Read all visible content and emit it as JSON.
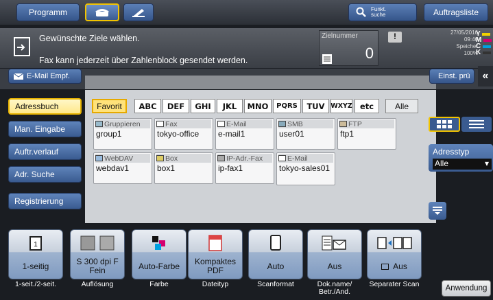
{
  "topbar": {
    "programm": "Programm",
    "funkt_line1": "Funkt.",
    "funkt_line2": "suche",
    "auftragsliste": "Auftragsliste"
  },
  "message": {
    "line1": "Gewünschte Ziele wählen.",
    "line2": "Fax kann jederzeit über Zahlenblock gesendet werden.",
    "zielnummer_label": "Zielnummer",
    "zielnummer_value": "0"
  },
  "status": {
    "date": "27/05/2016",
    "time": "09:46",
    "speicher_label": "Speicher",
    "speicher_value": "100%",
    "toner": [
      "Y",
      "M",
      "C",
      "K"
    ]
  },
  "row2": {
    "email_btn": "E-Mail Empf.",
    "einst_btn": "Einst. prü"
  },
  "sidebar": {
    "items": [
      "Adressbuch",
      "Man. Eingabe",
      "Auftr.verlauf",
      "Adr. Suche",
      "Registrierung"
    ]
  },
  "tabs": [
    "Favorit",
    "ABC",
    "DEF",
    "GHI",
    "JKL",
    "MNO",
    "PQRS",
    "TUV",
    "WXYZ",
    "etc",
    "Alle"
  ],
  "addresses": [
    {
      "type": "Gruppieren",
      "name": "group1"
    },
    {
      "type": "Fax",
      "name": "tokyo-office"
    },
    {
      "type": "E-Mail",
      "name": "e-mail1"
    },
    {
      "type": "SMB",
      "name": "user01"
    },
    {
      "type": "FTP",
      "name": "ftp1"
    },
    {
      "type": "WebDAV",
      "name": "webdav1"
    },
    {
      "type": "Box",
      "name": "box1"
    },
    {
      "type": "IP-Adr.-Fax",
      "name": "ip-fax1"
    },
    {
      "type": "E-Mail",
      "name": "tokyo-sales01"
    }
  ],
  "adresstyp": {
    "label": "Adresstyp",
    "value": "Alle"
  },
  "functions": [
    {
      "label": "1-seitig",
      "caption": "1-seit./2-seit."
    },
    {
      "label": "S 300 dpi F Fein",
      "caption": "Auflösung"
    },
    {
      "label": "Auto-Farbe",
      "caption": "Farbe"
    },
    {
      "label": "Kompaktes PDF",
      "caption": "Dateityp"
    },
    {
      "label": "Auto",
      "caption": "Scanformat"
    },
    {
      "label": "Aus",
      "caption": "Dok.name/ Betr./And."
    },
    {
      "label": "Aus",
      "caption": "Separater Scan"
    }
  ],
  "anwendung": "Anwendung",
  "colors": {
    "accent_blue": "#3a5b90",
    "highlight_yellow": "#ffe27a",
    "background": "#1a1d22"
  }
}
